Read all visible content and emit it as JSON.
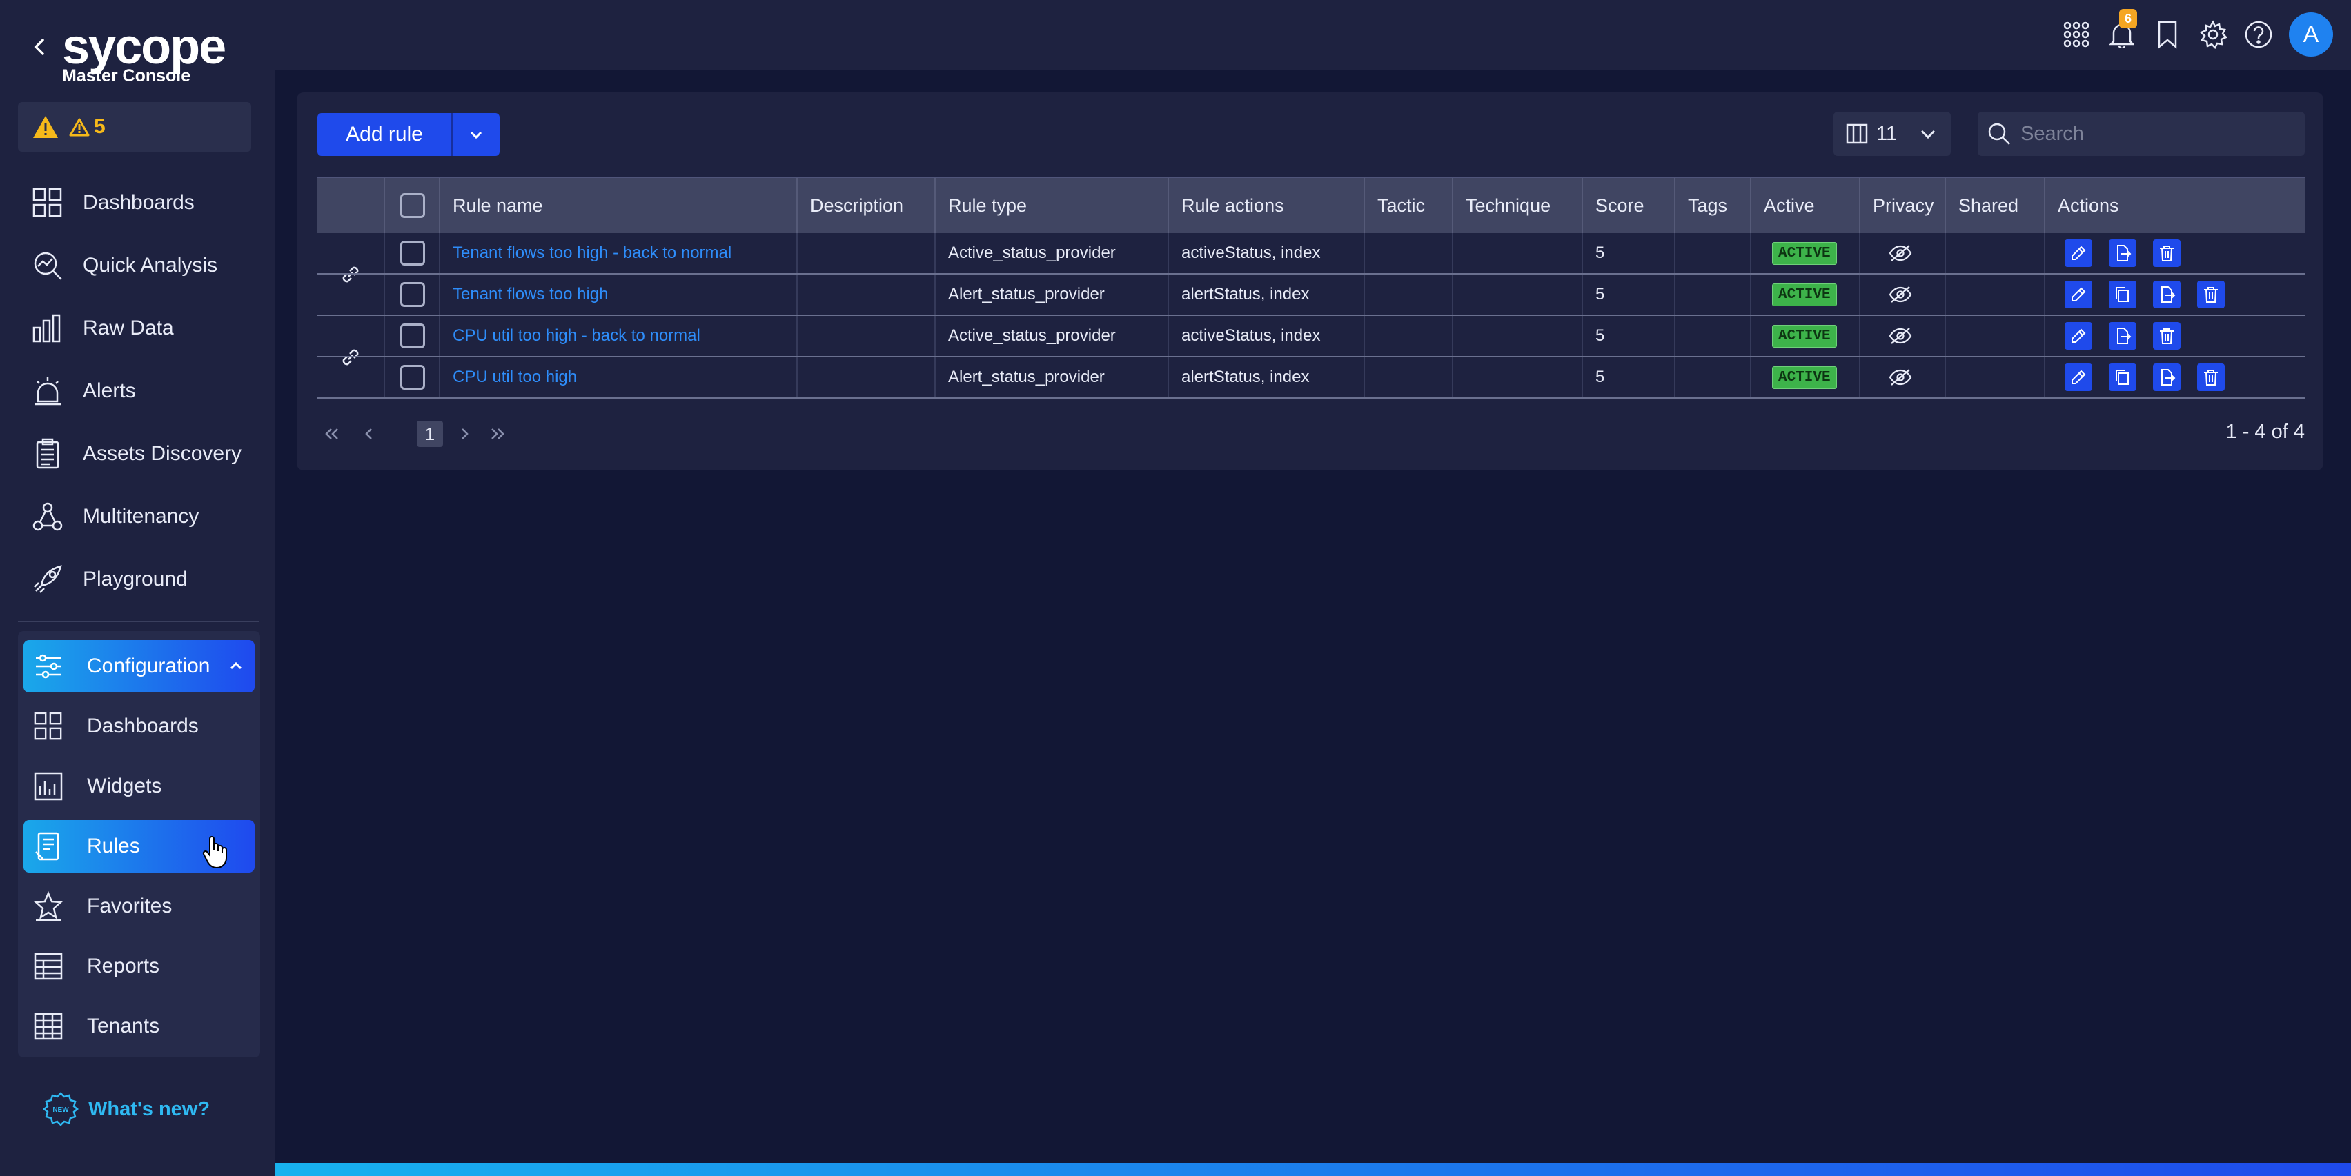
{
  "brand": {
    "logo": "sycope",
    "subtitle": "Master Console"
  },
  "alerts": {
    "count": "5"
  },
  "sidebar": {
    "items": [
      {
        "label": "Dashboards",
        "icon": "dashboards-icon"
      },
      {
        "label": "Quick Analysis",
        "icon": "quick-analysis-icon"
      },
      {
        "label": "Raw Data",
        "icon": "raw-data-icon"
      },
      {
        "label": "Alerts",
        "icon": "alerts-icon"
      },
      {
        "label": "Assets Discovery",
        "icon": "assets-discovery-icon"
      },
      {
        "label": "Multitenancy",
        "icon": "multitenancy-icon"
      },
      {
        "label": "Playground",
        "icon": "playground-icon"
      }
    ],
    "configuration": {
      "label": "Configuration",
      "items": [
        {
          "label": "Dashboards",
          "icon": "dashboards-icon"
        },
        {
          "label": "Widgets",
          "icon": "widgets-icon"
        },
        {
          "label": "Rules",
          "icon": "rules-icon"
        },
        {
          "label": "Favorites",
          "icon": "favorites-icon"
        },
        {
          "label": "Reports",
          "icon": "reports-icon"
        },
        {
          "label": "Tenants",
          "icon": "tenants-icon"
        }
      ]
    },
    "whats_new": "What's new?"
  },
  "topbar": {
    "notification_count": "6",
    "avatar_initial": "A"
  },
  "toolbar": {
    "add_rule": "Add rule",
    "column_count": "11",
    "search_placeholder": "Search"
  },
  "table": {
    "columns": [
      "Rule name",
      "Description",
      "Rule type",
      "Rule actions",
      "Tactic",
      "Technique",
      "Score",
      "Tags",
      "Active",
      "Privacy",
      "Shared",
      "Actions"
    ],
    "rows": [
      {
        "name": "Tenant flows too high - back to normal",
        "description": "",
        "type": "Active_status_provider",
        "actions": "activeStatus, index",
        "tactic": "",
        "technique": "",
        "score": "5",
        "tags": "",
        "active": "ACTIVE",
        "shared": ""
      },
      {
        "name": "Tenant flows too high",
        "description": "",
        "type": "Alert_status_provider",
        "actions": "alertStatus, index",
        "tactic": "",
        "technique": "",
        "score": "5",
        "tags": "",
        "active": "ACTIVE",
        "shared": ""
      },
      {
        "name": "CPU util too high - back to normal",
        "description": "",
        "type": "Active_status_provider",
        "actions": "activeStatus, index",
        "tactic": "",
        "technique": "",
        "score": "5",
        "tags": "",
        "active": "ACTIVE",
        "shared": ""
      },
      {
        "name": "CPU util too high",
        "description": "",
        "type": "Alert_status_provider",
        "actions": "alertStatus, index",
        "tactic": "",
        "technique": "",
        "score": "5",
        "tags": "",
        "active": "ACTIVE",
        "shared": ""
      }
    ]
  },
  "pagination": {
    "current_page": "1",
    "range": "1 - 4 of 4"
  },
  "colors": {
    "accent": "#1f4aeb",
    "accent_light": "#1aa8ea",
    "active_badge": "#3db34a",
    "warning": "#f6b91a",
    "link": "#2e8dfa"
  }
}
